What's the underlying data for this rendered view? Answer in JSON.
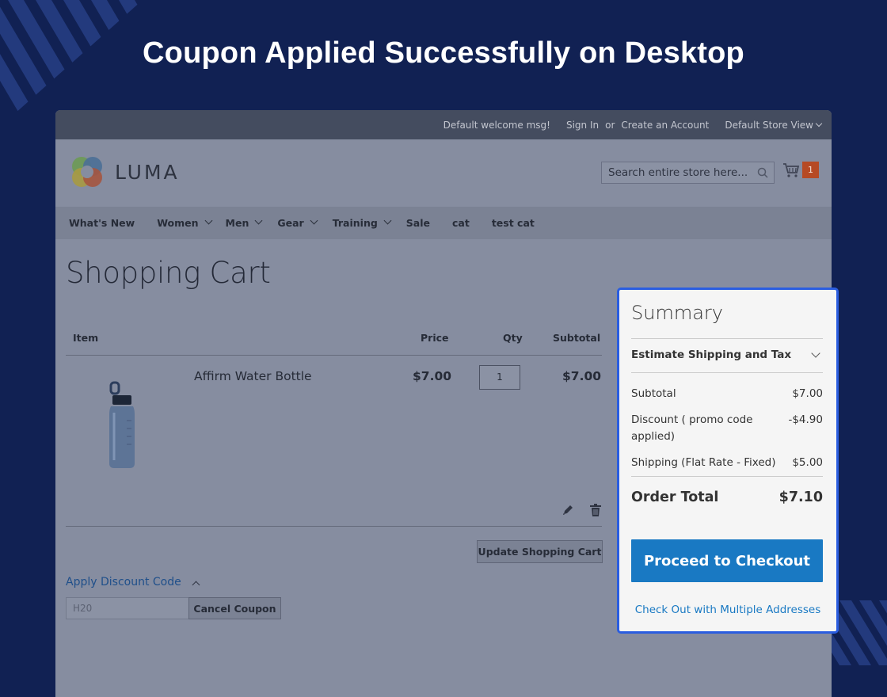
{
  "hero": {
    "title": "Coupon Applied Successfully on Desktop"
  },
  "topbar": {
    "welcome": "Default welcome msg!",
    "sign_in": "Sign In",
    "or": "or",
    "create_account": "Create an Account",
    "store_view": "Default Store View"
  },
  "header": {
    "logo_text": "LUMA",
    "search_placeholder": "Search entire store here...",
    "cart_count": "1"
  },
  "nav": {
    "items": [
      {
        "label": "What's New",
        "has_dropdown": false
      },
      {
        "label": "Women",
        "has_dropdown": true
      },
      {
        "label": "Men",
        "has_dropdown": true
      },
      {
        "label": "Gear",
        "has_dropdown": true
      },
      {
        "label": "Training",
        "has_dropdown": true
      },
      {
        "label": "Sale",
        "has_dropdown": false
      },
      {
        "label": "cat",
        "has_dropdown": false
      },
      {
        "label": "test cat",
        "has_dropdown": false
      }
    ]
  },
  "cart": {
    "title": "Shopping Cart",
    "columns": {
      "item": "Item",
      "price": "Price",
      "qty": "Qty",
      "subtotal": "Subtotal"
    },
    "items": [
      {
        "name": "Affirm Water Bottle",
        "price": "$7.00",
        "qty": "1",
        "subtotal": "$7.00"
      }
    ],
    "update_label": "Update Shopping Cart",
    "discount_link": "Apply Discount Code",
    "coupon_value": "H20",
    "cancel_coupon_label": "Cancel Coupon"
  },
  "summary": {
    "title": "Summary",
    "estimate_label": "Estimate Shipping and Tax",
    "subtotal_label": "Subtotal",
    "subtotal_value": "$7.00",
    "discount_label": "Discount ( promo code applied)",
    "discount_value": "-$4.90",
    "shipping_label": "Shipping (Flat Rate - Fixed)",
    "shipping_value": "$5.00",
    "order_total_label": "Order Total",
    "order_total_value": "$7.10",
    "checkout_label": "Proceed to Checkout",
    "multi_address_label": "Check Out with Multiple Addresses"
  },
  "colors": {
    "background": "#112153",
    "highlight_border": "#2a5de0",
    "checkout_button": "#1979c3",
    "cart_badge": "#b64a24"
  }
}
